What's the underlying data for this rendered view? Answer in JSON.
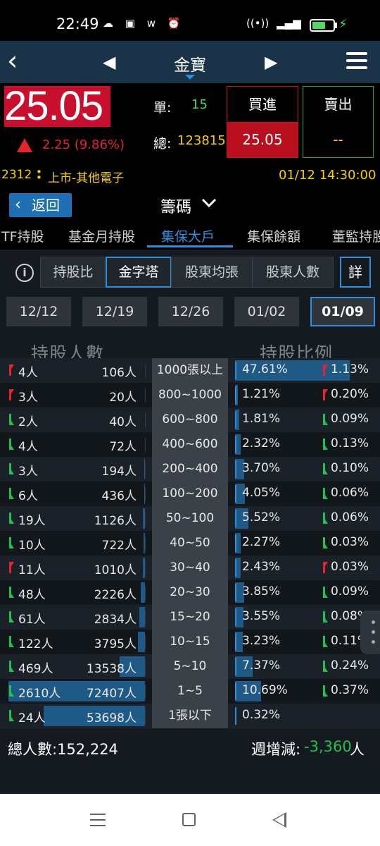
{
  "status_bar": {
    "time": "22:49",
    "left_icons": [
      "cloud-icon",
      "chat-icon",
      "w-app-icon",
      "alarm-icon"
    ],
    "right_icons": [
      "wifi-icon",
      "volte-icon",
      "signal-icon",
      "battery-icon",
      "charging-icon"
    ],
    "battery_level": 0.6
  },
  "nav": {
    "title": "金寶",
    "back_icon": "chevron-left-icon",
    "prev_icon": "triangle-left-icon",
    "next_icon": "triangle-right-icon",
    "menu_icon": "hamburger-icon"
  },
  "quote": {
    "price": "25.05",
    "change": "2.25 (9.86%)",
    "single_label": "單:",
    "single_value": "15",
    "total_label": "總:",
    "total_value": "123815",
    "buy_label": "買進",
    "buy_price": "25.05",
    "sell_label": "賣出",
    "sell_price": "--",
    "code": "2312",
    "market": "上市-其他電子",
    "datetime": "01/12 14:30:00"
  },
  "section": {
    "back_label": "返回",
    "title": "籌碼"
  },
  "tabs": [
    "TF持股",
    "基金月持股",
    "集保大戶",
    "集保餘額",
    "董監持股"
  ],
  "active_tab": "集保大戶",
  "segments": [
    "持股比",
    "金字塔",
    "股東均張",
    "股東人數"
  ],
  "active_segment": "金字塔",
  "detail_label": "詳",
  "dates": [
    "12/12",
    "12/19",
    "12/26",
    "01/02",
    "01/09"
  ],
  "active_date": "01/09",
  "headers": {
    "left": "持股人數",
    "right": "持股比例"
  },
  "rows": [
    {
      "dir": "up",
      "count_chg": "4人",
      "holders": "106人",
      "range": "1000張以上",
      "pct": "47.61%",
      "pct_chg_dir": "up",
      "pct_chg": "1.13%",
      "holders_frac": 0.0,
      "pct_frac": 1.0
    },
    {
      "dir": "up",
      "count_chg": "3人",
      "holders": "20人",
      "range": "800~1000",
      "pct": "1.21%",
      "pct_chg_dir": "up",
      "pct_chg": "0.20%",
      "holders_frac": 0.0,
      "pct_frac": 0.025
    },
    {
      "dir": "down",
      "count_chg": "2人",
      "holders": "40人",
      "range": "600~800",
      "pct": "1.81%",
      "pct_chg_dir": "down",
      "pct_chg": "0.09%",
      "holders_frac": 0.0,
      "pct_frac": 0.038
    },
    {
      "dir": "down",
      "count_chg": "4人",
      "holders": "72人",
      "range": "400~600",
      "pct": "2.32%",
      "pct_chg_dir": "down",
      "pct_chg": "0.13%",
      "holders_frac": 0.0,
      "pct_frac": 0.049
    },
    {
      "dir": "down",
      "count_chg": "3人",
      "holders": "194人",
      "range": "200~400",
      "pct": "3.70%",
      "pct_chg_dir": "down",
      "pct_chg": "0.10%",
      "holders_frac": 0.003,
      "pct_frac": 0.078
    },
    {
      "dir": "down",
      "count_chg": "6人",
      "holders": "436人",
      "range": "100~200",
      "pct": "4.05%",
      "pct_chg_dir": "down",
      "pct_chg": "0.06%",
      "holders_frac": 0.006,
      "pct_frac": 0.085
    },
    {
      "dir": "down",
      "count_chg": "19人",
      "holders": "1126人",
      "range": "50~100",
      "pct": "5.52%",
      "pct_chg_dir": "down",
      "pct_chg": "0.06%",
      "holders_frac": 0.016,
      "pct_frac": 0.116
    },
    {
      "dir": "down",
      "count_chg": "10人",
      "holders": "722人",
      "range": "40~50",
      "pct": "2.27%",
      "pct_chg_dir": "down",
      "pct_chg": "0.03%",
      "holders_frac": 0.01,
      "pct_frac": 0.048
    },
    {
      "dir": "up",
      "count_chg": "11人",
      "holders": "1010人",
      "range": "30~40",
      "pct": "2.43%",
      "pct_chg_dir": "up",
      "pct_chg": "0.03%",
      "holders_frac": 0.014,
      "pct_frac": 0.051
    },
    {
      "dir": "down",
      "count_chg": "48人",
      "holders": "2226人",
      "range": "20~30",
      "pct": "3.85%",
      "pct_chg_dir": "down",
      "pct_chg": "0.09%",
      "holders_frac": 0.031,
      "pct_frac": 0.081
    },
    {
      "dir": "down",
      "count_chg": "61人",
      "holders": "2834人",
      "range": "15~20",
      "pct": "3.55%",
      "pct_chg_dir": "down",
      "pct_chg": "0.08%",
      "holders_frac": 0.039,
      "pct_frac": 0.075
    },
    {
      "dir": "down",
      "count_chg": "122人",
      "holders": "3795人",
      "range": "10~15",
      "pct": "3.23%",
      "pct_chg_dir": "down",
      "pct_chg": "0.11%",
      "holders_frac": 0.052,
      "pct_frac": 0.068
    },
    {
      "dir": "down",
      "count_chg": "469人",
      "holders": "13538人",
      "range": "5~10",
      "pct": "7.37%",
      "pct_chg_dir": "down",
      "pct_chg": "0.24%",
      "holders_frac": 0.187,
      "pct_frac": 0.155
    },
    {
      "dir": "down",
      "count_chg": "2610人",
      "holders": "72407人",
      "range": "1~5",
      "pct": "10.69%",
      "pct_chg_dir": "down",
      "pct_chg": "0.37%",
      "holders_frac": 1.0,
      "pct_frac": 0.225
    },
    {
      "dir": "down",
      "count_chg": "24人",
      "holders": "53698人",
      "range": "1張以下",
      "pct": "0.32%",
      "pct_chg_dir": "",
      "pct_chg": "",
      "holders_frac": 0.742,
      "pct_frac": 0.0
    }
  ],
  "totals": {
    "holders_label": "總人數:152,224",
    "weekly_label": "週增減:",
    "weekly_value": "-3,360",
    "weekly_unit": "人"
  },
  "colors": {
    "up": "#e4262c",
    "down": "#1fc14f",
    "accent": "#2a8fdc",
    "bar": "#1f5a86",
    "highlight": "#f5d000"
  },
  "system_nav": [
    "recent-apps-icon",
    "home-icon",
    "back-icon"
  ]
}
